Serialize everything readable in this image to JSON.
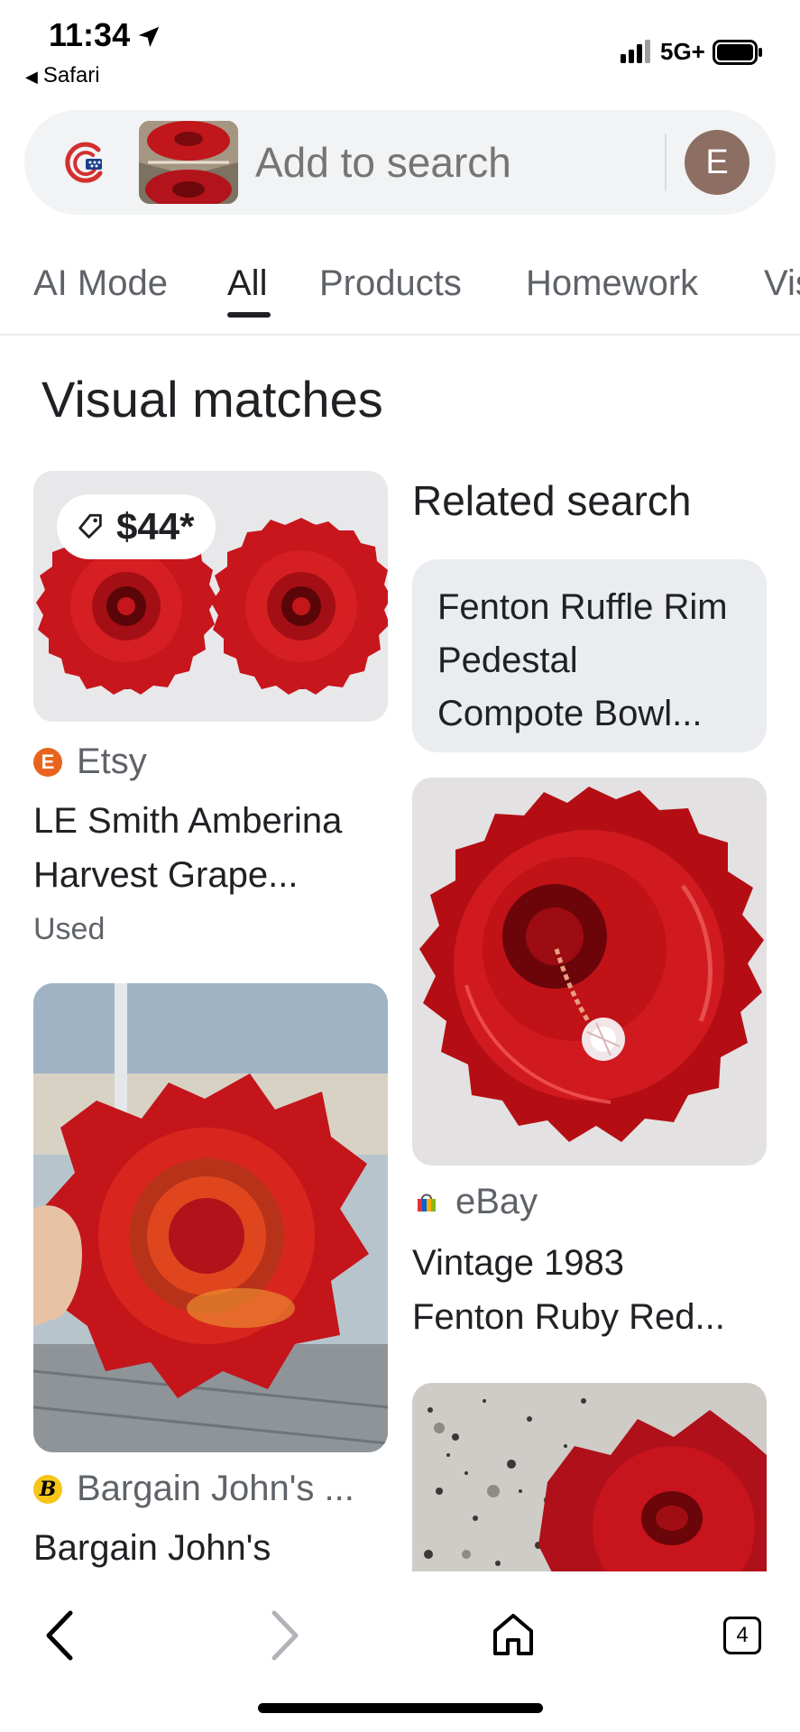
{
  "status_bar": {
    "time": "11:34",
    "back_app": "Safari",
    "network": "5G+"
  },
  "search": {
    "placeholder": "Add to search",
    "avatar_letter": "E"
  },
  "tabs": [
    {
      "label": "AI Mode"
    },
    {
      "label": "All"
    },
    {
      "label": "Products"
    },
    {
      "label": "Homework"
    },
    {
      "label": "Vis"
    }
  ],
  "section_title": "Visual matches",
  "results_left": [
    {
      "price": "$44*",
      "source": "Etsy",
      "title_line1": "LE Smith Amberina",
      "title_line2": "Harvest Grape...",
      "condition": "Used"
    },
    {
      "source": "Bargain John's ...",
      "title_line1": "Bargain John's"
    }
  ],
  "related": {
    "heading": "Related search",
    "line1": "Fenton Ruffle Rim",
    "line2": "Pedestal",
    "line3": "Compote Bowl..."
  },
  "results_right": [
    {
      "source": "eBay",
      "title_line1": "Vintage 1983",
      "title_line2": "Fenton Ruby Red..."
    }
  ],
  "toolbar": {
    "tab_count": "4"
  },
  "colors": {
    "accent": "#202124",
    "avatar": "#8d6e63",
    "ruby": "#d0141a",
    "etsy": "#e8641e"
  }
}
